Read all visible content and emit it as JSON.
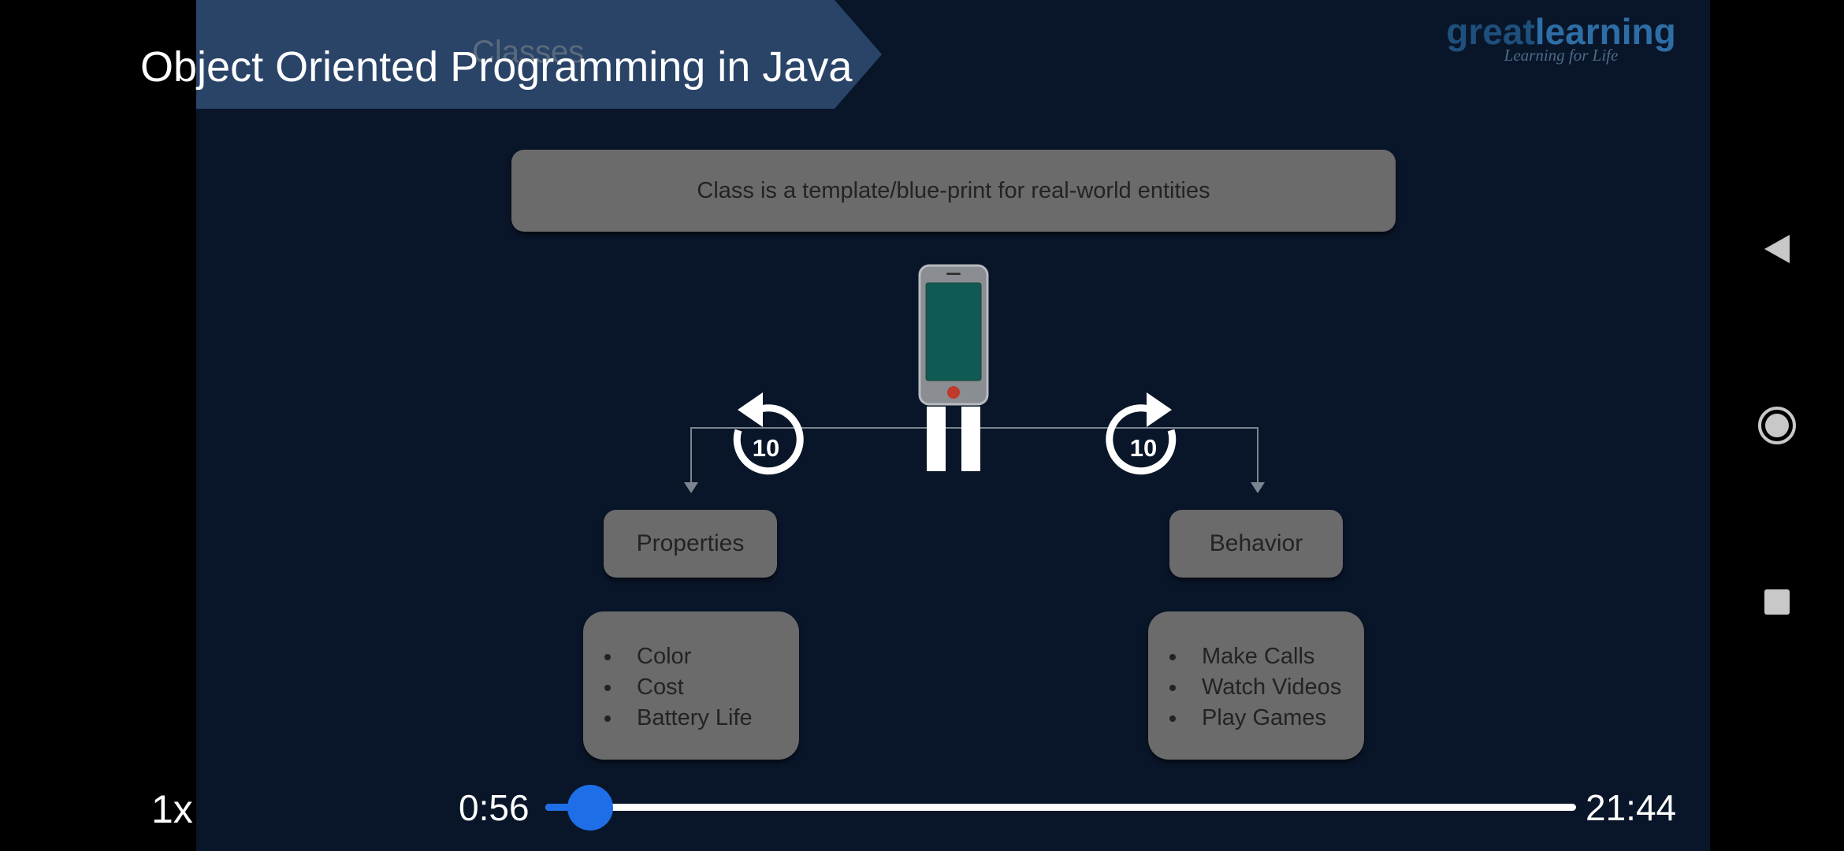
{
  "video": {
    "title": "Object Oriented Programming in Java",
    "speed": "1x",
    "current_time": "0:56",
    "duration": "21:44",
    "progress": 0.0433
  },
  "controls": {
    "rewind_seconds": "10",
    "forward_seconds": "10"
  },
  "slide": {
    "heading": "Classes",
    "logo": {
      "part1": "great",
      "part2": "learning",
      "tagline": "Learning for Life"
    },
    "definition": "Class is a template/blue-print for real-world entities",
    "properties": {
      "label": "Properties",
      "items": [
        "Color",
        "Cost",
        "Battery Life"
      ]
    },
    "behavior": {
      "label": "Behavior",
      "items": [
        "Make Calls",
        "Watch Videos",
        "Play Games"
      ]
    }
  },
  "icons": {
    "close": "close-icon",
    "rewind": "replay-10-icon",
    "forward": "forward-10-icon",
    "pause": "pause-icon",
    "nav_back": "back-triangle-icon",
    "nav_home": "home-circle-icon",
    "nav_recents": "recents-square-icon"
  },
  "colors": {
    "accent": "#1e6ee8",
    "slide_background": "#091629"
  }
}
